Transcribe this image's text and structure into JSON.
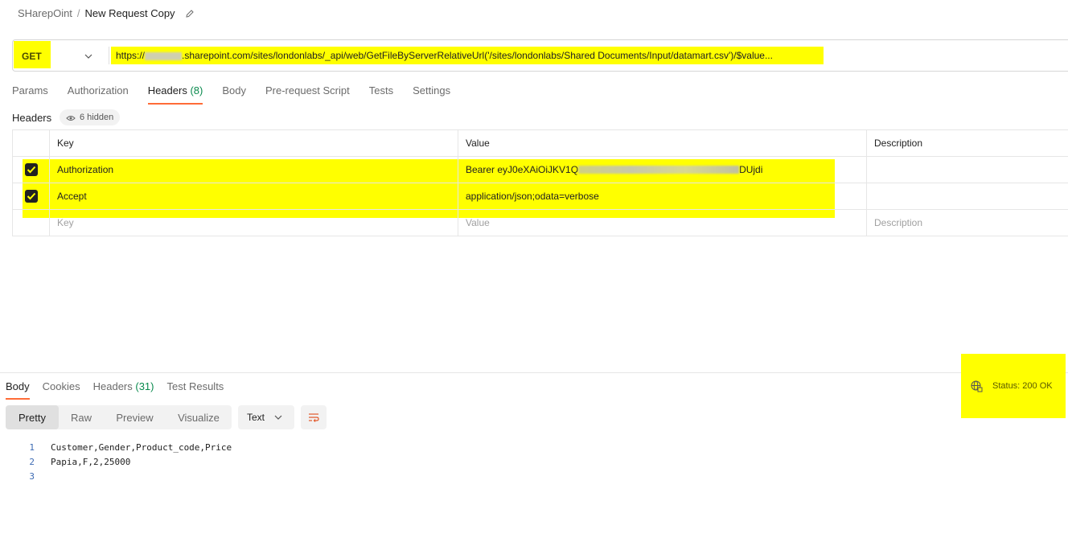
{
  "breadcrumb": {
    "parent": "SHarepOint",
    "separator": "/",
    "current": "New Request Copy"
  },
  "request": {
    "method": "GET",
    "url_prefix": "https://",
    "url_rest": ".sharepoint.com/sites/londonlabs/_api/web/GetFileByServerRelativeUrl('/sites/londonlabs/Shared Documents/Input/datamart.csv')/$value..."
  },
  "request_tabs": [
    {
      "label": "Params",
      "count": ""
    },
    {
      "label": "Authorization",
      "count": ""
    },
    {
      "label": "Headers",
      "count": "(8)"
    },
    {
      "label": "Body",
      "count": ""
    },
    {
      "label": "Pre-request Script",
      "count": ""
    },
    {
      "label": "Tests",
      "count": ""
    },
    {
      "label": "Settings",
      "count": ""
    }
  ],
  "headers_section": {
    "label": "Headers",
    "hidden_count": "6 hidden"
  },
  "headers_table": {
    "columns": [
      "Key",
      "Value",
      "Description"
    ],
    "rows": [
      {
        "key": "Authorization",
        "value_prefix": "Bearer eyJ0eXAiOiJKV1Q",
        "value_suffix": "DUjdi",
        "checked": true
      },
      {
        "key": "Accept",
        "value": "application/json;odata=verbose",
        "checked": true
      }
    ],
    "placeholder": {
      "key": "Key",
      "value": "Value",
      "description": "Description"
    }
  },
  "response_tabs": [
    {
      "label": "Body",
      "count": ""
    },
    {
      "label": "Cookies",
      "count": ""
    },
    {
      "label": "Headers",
      "count": "(31)"
    },
    {
      "label": "Test Results",
      "count": ""
    }
  ],
  "status": "Status: 200 OK",
  "view_modes": [
    "Pretty",
    "Raw",
    "Preview",
    "Visualize"
  ],
  "format_select": "Text",
  "response_body": [
    {
      "line": "1",
      "text": "Customer,Gender,Product_code,Price"
    },
    {
      "line": "2",
      "text": "Papia,F,2,25000"
    },
    {
      "line": "3",
      "text": ""
    }
  ],
  "colors": {
    "highlight": "#ffff00",
    "accent": "#ff6c37",
    "count_green": "#0a8a4e"
  }
}
